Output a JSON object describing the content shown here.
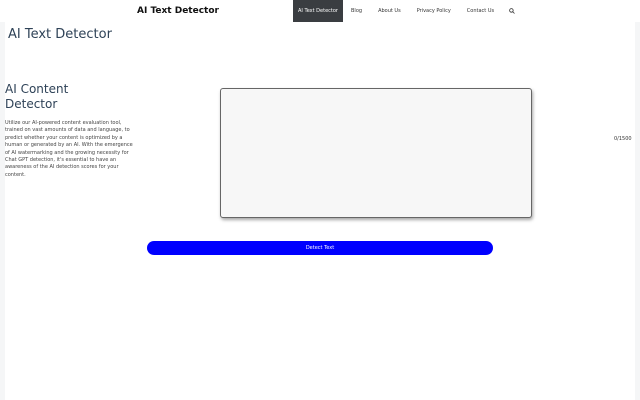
{
  "header": {
    "brand": "AI Text Detector",
    "nav": [
      {
        "label": "AI Text Detector",
        "active": true
      },
      {
        "label": "Blog"
      },
      {
        "label": "About Us"
      },
      {
        "label": "Privacy Policy"
      },
      {
        "label": "Contact Us"
      }
    ],
    "search_icon": "search-icon"
  },
  "main": {
    "page_title": "AI Text Detector",
    "section_title": "AI Content Detector",
    "description": "Utilize our AI-powered content evaluation tool, trained on vast amounts of data and language, to predict whether your content is optimized by a human or generated by an AI. With the emergence of AI watermarking and the growing necessity for Chat GPT detection, it's essential to have an awareness of the AI detection scores for your content.",
    "textarea_value": "",
    "char_counter": "0/1500",
    "detect_button": "Detect Text"
  },
  "colors": {
    "accent": "#0000ff",
    "nav_active_bg": "#3a3d41",
    "heading": "#2e4257"
  }
}
